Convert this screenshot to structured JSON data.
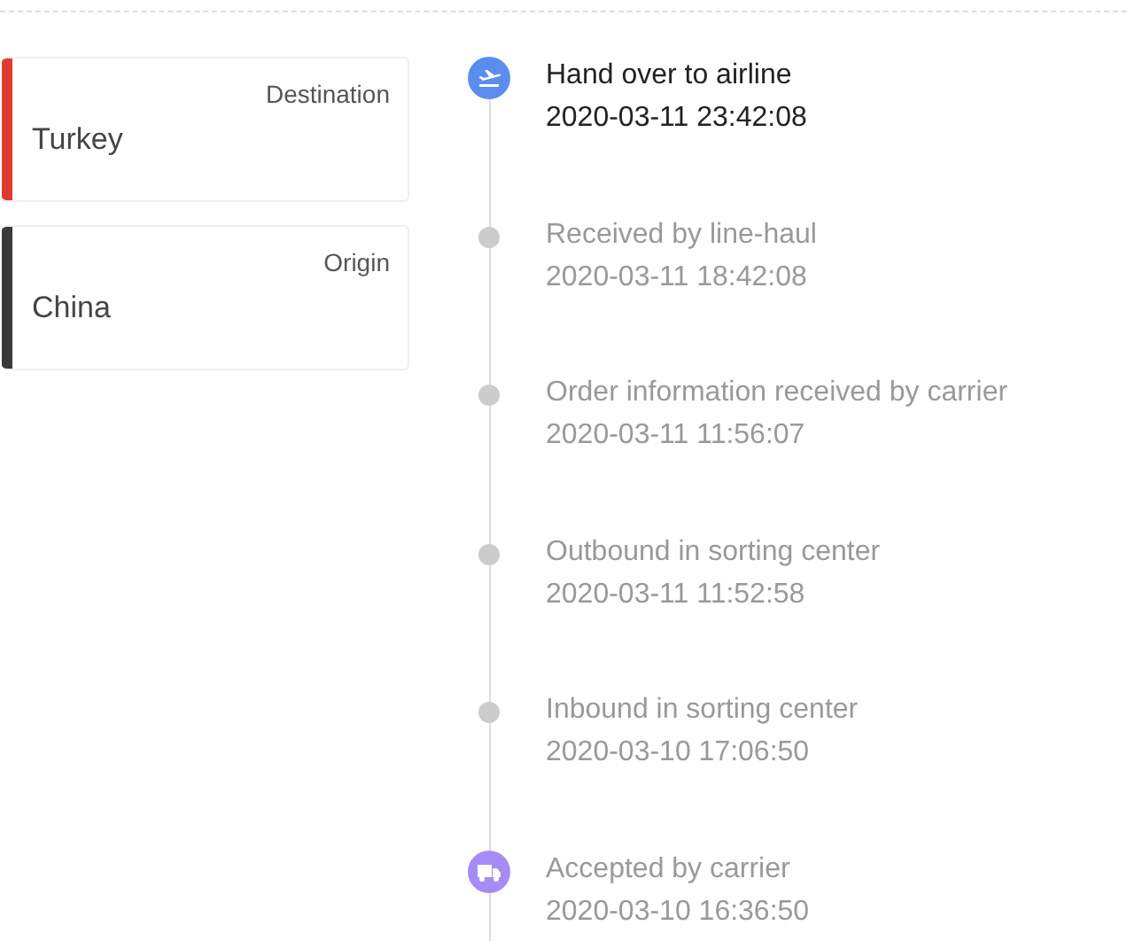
{
  "places": [
    {
      "label": "Destination",
      "value": "Turkey",
      "color": "#e03a2f"
    },
    {
      "label": "Origin",
      "value": "China",
      "color": "#3a3a3a"
    }
  ],
  "events": [
    {
      "kind": "plane",
      "title": "Hand over to airline",
      "time": "2020-03-11 23:42:08",
      "current": true
    },
    {
      "kind": "dot",
      "title": "Received by line-haul",
      "time": "2020-03-11 18:42:08",
      "current": false
    },
    {
      "kind": "dot",
      "title": "Order information received by carrier",
      "time": "2020-03-11 11:56:07",
      "current": false
    },
    {
      "kind": "dot",
      "title": "Outbound in sorting center",
      "time": "2020-03-11 11:52:58",
      "current": false
    },
    {
      "kind": "dot",
      "title": "Inbound in sorting center",
      "time": "2020-03-10 17:06:50",
      "current": false
    },
    {
      "kind": "truck",
      "title": "Accepted by carrier",
      "time": "2020-03-10 16:36:50",
      "current": false
    }
  ]
}
